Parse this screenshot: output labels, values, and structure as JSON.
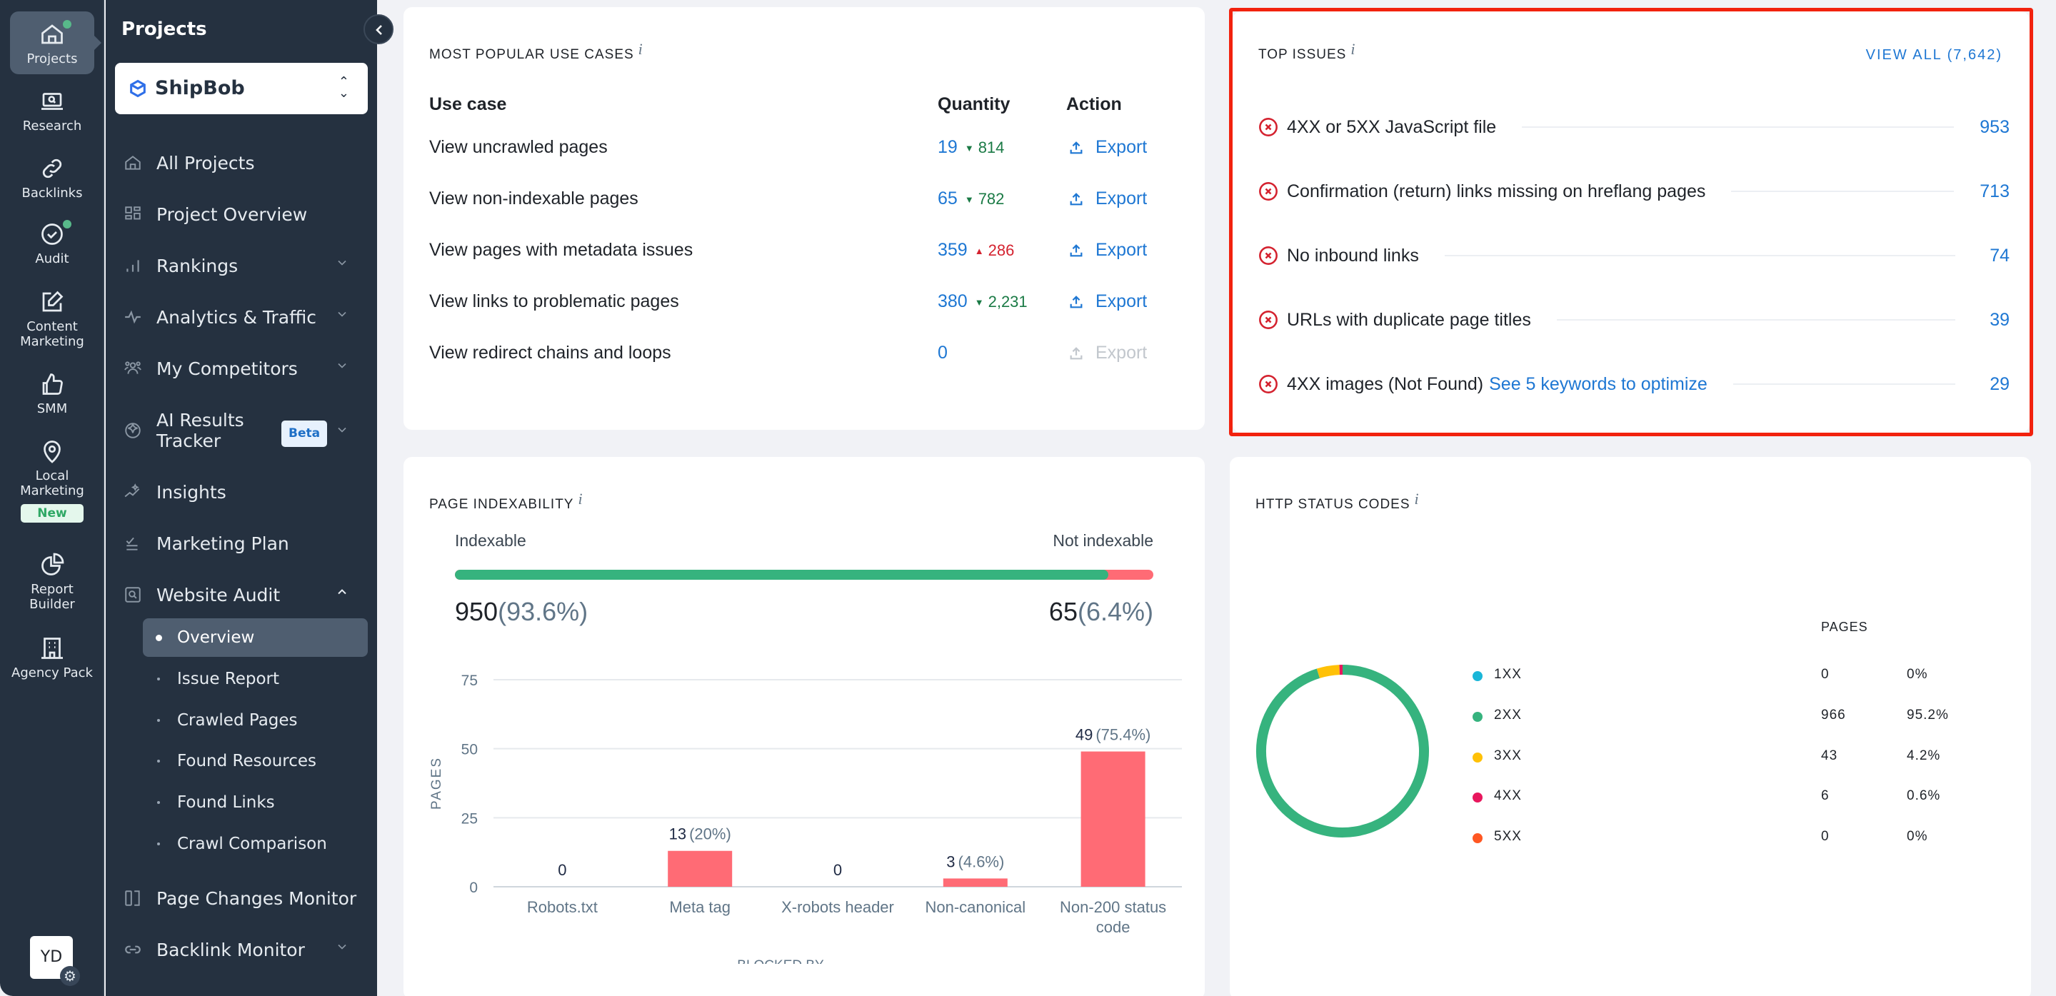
{
  "rail": {
    "items": [
      {
        "label": "Projects",
        "icon": "home-icon",
        "active": true,
        "dot": true
      },
      {
        "label": "Research",
        "icon": "laptop-search-icon"
      },
      {
        "label": "Backlinks",
        "icon": "link-icon"
      },
      {
        "label": "Audit",
        "icon": "check-circle-icon",
        "dot": true
      },
      {
        "label": "Content Marketing",
        "icon": "edit-icon"
      },
      {
        "label": "SMM",
        "icon": "thumbs-up-icon"
      },
      {
        "label": "Local Marketing",
        "icon": "location-pin-icon",
        "badge": "New"
      },
      {
        "label": "Report Builder",
        "icon": "pie-chart-icon"
      },
      {
        "label": "Agency Pack",
        "icon": "building-icon"
      }
    ],
    "avatar": "YD"
  },
  "sidebar": {
    "title": "Projects",
    "project": "ShipBob",
    "items": [
      {
        "label": "All Projects",
        "icon": "home-icon"
      },
      {
        "label": "Project Overview",
        "icon": "grid-icon"
      },
      {
        "label": "Rankings",
        "icon": "bar-chart-icon",
        "expandable": true
      },
      {
        "label": "Analytics & Traffic",
        "icon": "pulse-icon",
        "expandable": true
      },
      {
        "label": "My Competitors",
        "icon": "users-icon",
        "expandable": true,
        "dot": true
      },
      {
        "label": "AI Results Tracker",
        "icon": "ai-sparkle-icon",
        "expandable": true,
        "badge": "Beta"
      },
      {
        "label": "Insights",
        "icon": "insights-icon"
      },
      {
        "label": "Marketing Plan",
        "icon": "checklist-icon"
      },
      {
        "label": "Website Audit",
        "icon": "audit-icon",
        "expanded": true
      },
      {
        "label": "Page Changes Monitor",
        "icon": "compare-icon"
      },
      {
        "label": "Backlink Monitor",
        "icon": "link-icon",
        "expandable": true
      }
    ],
    "audit_subitems": [
      {
        "label": "Overview",
        "active": true
      },
      {
        "label": "Issue Report"
      },
      {
        "label": "Crawled Pages"
      },
      {
        "label": "Found Resources"
      },
      {
        "label": "Found Links"
      },
      {
        "label": "Crawl Comparison"
      }
    ]
  },
  "use_cases": {
    "title": "MOST POPULAR USE CASES",
    "info": "i",
    "headers": {
      "use_case": "Use case",
      "quantity": "Quantity",
      "action": "Action"
    },
    "rows": [
      {
        "label": "View uncrawled pages",
        "qty": "19",
        "delta": "814",
        "delta_dir": "down",
        "action": "Export",
        "enabled": true
      },
      {
        "label": "View non-indexable pages",
        "qty": "65",
        "delta": "782",
        "delta_dir": "down",
        "action": "Export",
        "enabled": true
      },
      {
        "label": "View pages with metadata issues",
        "qty": "359",
        "delta": "286",
        "delta_dir": "up",
        "action": "Export",
        "enabled": true
      },
      {
        "label": "View links to problematic pages",
        "qty": "380",
        "delta": "2,231",
        "delta_dir": "down",
        "action": "Export",
        "enabled": true
      },
      {
        "label": "View redirect chains and loops",
        "qty": "0",
        "delta": "",
        "delta_dir": "",
        "action": "Export",
        "enabled": false
      }
    ]
  },
  "top_issues": {
    "title": "TOP ISSUES",
    "info": "i",
    "view_all": "VIEW ALL (7,642)",
    "items": [
      {
        "label": "4XX or 5XX JavaScript file",
        "link": "",
        "count": "953"
      },
      {
        "label": "Confirmation (return) links missing on hreflang pages",
        "link": "",
        "count": "713"
      },
      {
        "label": "No inbound links",
        "link": "",
        "count": "74"
      },
      {
        "label": "URLs with duplicate page titles",
        "link": "",
        "count": "39"
      },
      {
        "label": "4XX images (Not Found)",
        "link": "See 5 keywords to optimize",
        "count": "29"
      }
    ]
  },
  "indexability": {
    "title": "PAGE INDEXABILITY",
    "info": "i",
    "indexable_label": "Indexable",
    "not_indexable_label": "Not indexable",
    "indexable_count": "950",
    "indexable_pct": "(93.6%)",
    "not_indexable_count": "65",
    "not_indexable_pct": "(6.4%)",
    "indexable_fraction": 0.936,
    "colors": {
      "indexable": "#36b37e",
      "not_indexable": "#ff6b75"
    }
  },
  "http_status": {
    "title": "HTTP STATUS CODES",
    "info": "i",
    "pages_header": "PAGES"
  },
  "chart_data": [
    {
      "type": "bar",
      "title": "PAGE INDEXABILITY",
      "categories": [
        "Robots.txt",
        "Meta tag",
        "X-robots header",
        "Non-canonical",
        "Non-200 status code"
      ],
      "values": [
        0,
        13,
        0,
        3,
        49
      ],
      "labels": [
        "0",
        "13",
        "0",
        "3",
        "49"
      ],
      "pct_labels": [
        "",
        "(20%)",
        "",
        "(4.6%)",
        "(75.4%)"
      ],
      "xlabel": "BLOCKED BY",
      "ylabel": "PAGES",
      "ylim": [
        0,
        75
      ],
      "yticks": [
        0,
        25,
        50,
        75
      ],
      "grid": true,
      "color": "#ff6b75"
    },
    {
      "type": "pie",
      "title": "HTTP STATUS CODES",
      "donut": true,
      "categories": [
        "1XX",
        "2XX",
        "3XX",
        "4XX",
        "5XX"
      ],
      "values": [
        0,
        966,
        43,
        6,
        0
      ],
      "percents": [
        "0%",
        "95.2%",
        "4.2%",
        "0.6%",
        "0%"
      ],
      "colors": [
        "#1ab6d8",
        "#36b37e",
        "#ffc107",
        "#e8175d",
        "#ff5722"
      ],
      "legend": "right"
    }
  ]
}
